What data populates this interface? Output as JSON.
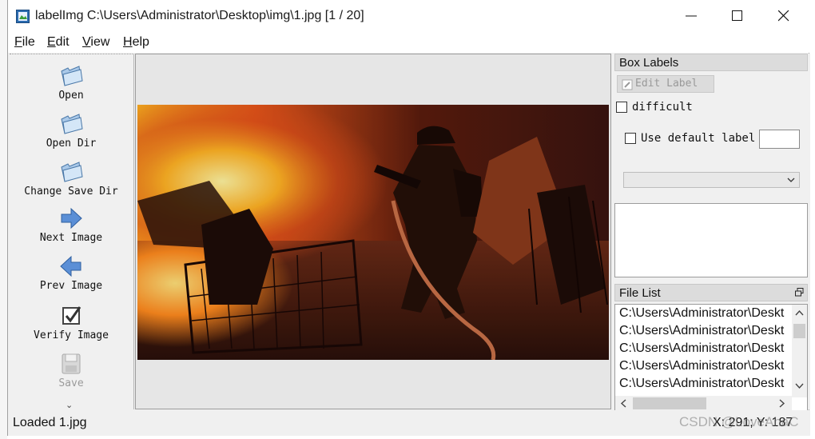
{
  "window": {
    "title": "labelImg C:\\Users\\Administrator\\Desktop\\img\\1.jpg [1 / 20]",
    "controls": [
      "minimize-icon",
      "maximize-icon",
      "close-icon"
    ]
  },
  "menu": [
    {
      "key": "F",
      "rest": "ile"
    },
    {
      "key": "E",
      "rest": "dit"
    },
    {
      "key": "V",
      "rest": "iew"
    },
    {
      "key": "H",
      "rest": "elp"
    }
  ],
  "toolbar": {
    "open": "Open",
    "open_dir": "Open Dir",
    "change_save_dir": "Change Save Dir",
    "next_image": "Next Image",
    "prev_image": "Prev Image",
    "verify_image": "Verify Image",
    "save": "Save",
    "more": "⌄"
  },
  "box_labels": {
    "title": "Box Labels",
    "edit_label": "Edit Label",
    "difficult": "difficult",
    "use_default_label": "Use default label",
    "default_label_value": "",
    "combo_value": ""
  },
  "file_list": {
    "title": "File List",
    "items": [
      "C:\\Users\\Administrator\\Deskt",
      "C:\\Users\\Administrator\\Deskt",
      "C:\\Users\\Administrator\\Deskt",
      "C:\\Users\\Administrator\\Deskt",
      "C:\\Users\\Administrator\\Deskt"
    ]
  },
  "status": {
    "message": "Loaded 1.jpg",
    "coords": "X: 291; Y: 187"
  },
  "watermark": "CSDN @LoveAhaC",
  "colors": {
    "accent_blue": "#3a7bd5",
    "window_bg": "#f0f0f0",
    "dock_title_bg": "#dcdcdc"
  }
}
